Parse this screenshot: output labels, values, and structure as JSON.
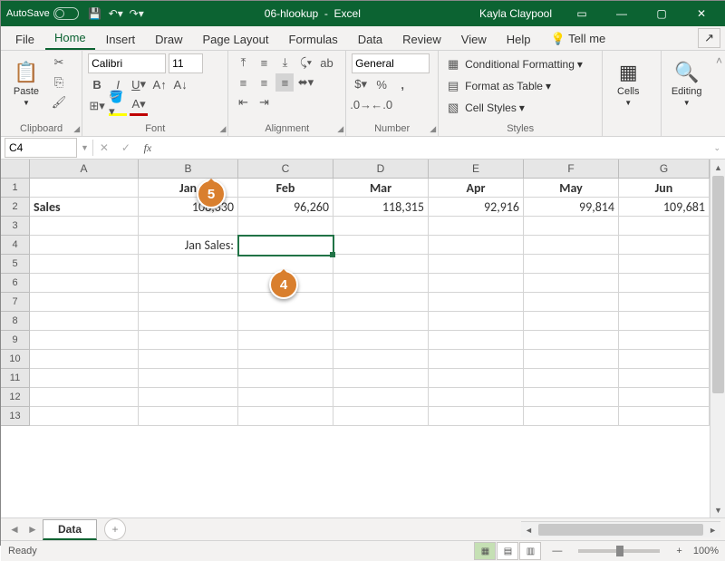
{
  "title": {
    "autosave": "AutoSave",
    "filename": "06-hlookup",
    "app": "Excel",
    "user": "Kayla Claypool"
  },
  "tabs": {
    "file": "File",
    "home": "Home",
    "insert": "Insert",
    "draw": "Draw",
    "pagelayout": "Page Layout",
    "formulas": "Formulas",
    "data": "Data",
    "review": "Review",
    "view": "View",
    "help": "Help",
    "tellme": "Tell me"
  },
  "ribbon": {
    "clipboard": {
      "label": "Clipboard",
      "paste": "Paste"
    },
    "font": {
      "label": "Font",
      "name": "Calibri",
      "size": "11"
    },
    "alignment": {
      "label": "Alignment"
    },
    "number": {
      "label": "Number",
      "format": "General"
    },
    "styles": {
      "label": "Styles",
      "cond": "Conditional Formatting",
      "table": "Format as Table",
      "cell": "Cell Styles"
    },
    "cells": {
      "label": "Cells"
    },
    "editing": {
      "label": "Editing"
    }
  },
  "namebox": "C4",
  "cols": {
    "A": "A",
    "B": "B",
    "C": "C",
    "D": "D",
    "E": "E",
    "F": "F",
    "G": "G"
  },
  "rows": [
    "1",
    "2",
    "3",
    "4",
    "5",
    "6",
    "7",
    "8",
    "9",
    "10",
    "11",
    "12",
    "13"
  ],
  "data": {
    "B1": "Jan",
    "C1": "Feb",
    "D1": "Mar",
    "E1": "Apr",
    "F1": "May",
    "G1": "Jun",
    "A2": "Sales",
    "B2": "108,330",
    "C2": "96,260",
    "D2": "118,315",
    "E2": "92,916",
    "F2": "99,814",
    "G2": "109,681",
    "B4": "Jan Sales:"
  },
  "sheet": {
    "name": "Data"
  },
  "status": {
    "ready": "Ready",
    "zoom": "100%"
  },
  "callouts": {
    "c4": "4",
    "c5": "5"
  }
}
